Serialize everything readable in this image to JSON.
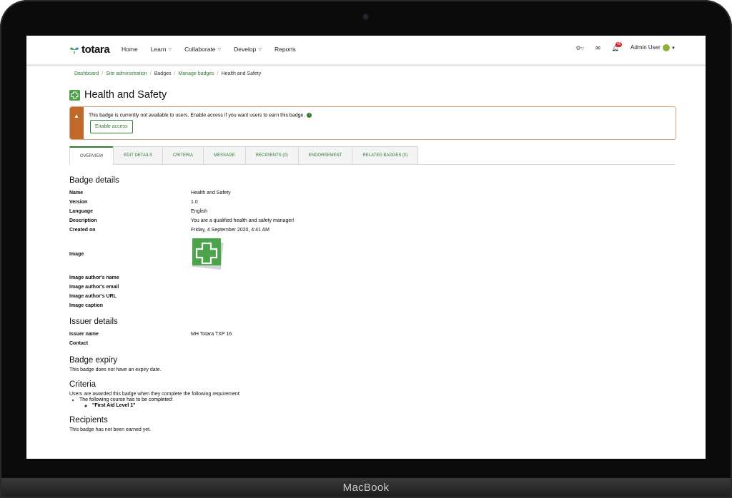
{
  "device": {
    "label": "MacBook"
  },
  "brand": {
    "name": "totara",
    "accent": "#2e7d32"
  },
  "nav": {
    "items": [
      {
        "label": "Home",
        "caret": false
      },
      {
        "label": "Learn",
        "caret": true
      },
      {
        "label": "Collaborate",
        "caret": true
      },
      {
        "label": "Develop",
        "caret": true
      },
      {
        "label": "Reports",
        "caret": false
      }
    ],
    "notifications_count": "45",
    "user_name": "Admin User"
  },
  "breadcrumb": [
    "Dashboard",
    "Site administration",
    "Badges",
    "Manage badges",
    "Health and Safety"
  ],
  "page_title": "Health and Safety",
  "alert": {
    "message": "This badge is currently not available to users. Enable access if you want users to earn this badge.",
    "button": "Enable access"
  },
  "tabs": [
    "OVERVIEW",
    "EDIT DETAILS",
    "CRITERIA",
    "MESSAGE",
    "RECIPIENTS (0)",
    "ENDORSEMENT",
    "RELATED BADGES (0)"
  ],
  "badge_details": {
    "heading": "Badge details",
    "rows": [
      {
        "label": "Name",
        "value": "Health and Safety"
      },
      {
        "label": "Version",
        "value": "1.0"
      },
      {
        "label": "Language",
        "value": "English"
      },
      {
        "label": "Description",
        "value": "You are a qualified health and safety manager!"
      },
      {
        "label": "Created on",
        "value": "Friday, 4 September 2020, 4:41 AM"
      }
    ],
    "image_label": "Image",
    "image_rows": [
      {
        "label": "Image author's name",
        "value": ""
      },
      {
        "label": "Image author's email",
        "value": ""
      },
      {
        "label": "Image author's URL",
        "value": ""
      },
      {
        "label": "Image caption",
        "value": ""
      }
    ]
  },
  "issuer": {
    "heading": "Issuer details",
    "rows": [
      {
        "label": "Issuer name",
        "value": "MH Totara TXP 16"
      },
      {
        "label": "Contact",
        "value": ""
      }
    ]
  },
  "expiry": {
    "heading": "Badge expiry",
    "text": "This badge does not have an expiry date."
  },
  "criteria": {
    "heading": "Criteria",
    "intro": "Users are awarded this badge when they complete the following requirement:",
    "item": "The following course has to be completed:",
    "subitem": "\"First Aid Level 1\""
  },
  "recipients": {
    "heading": "Recipients",
    "text": "This badge has not been earned yet."
  }
}
